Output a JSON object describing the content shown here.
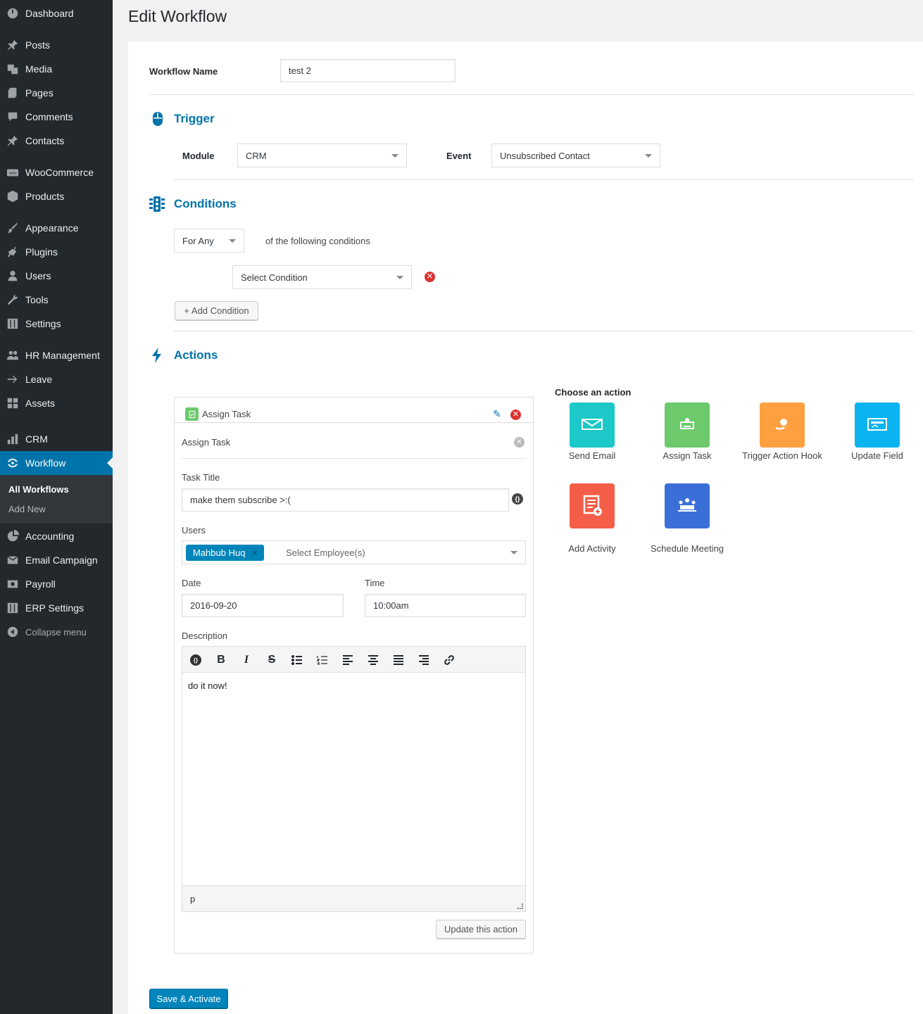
{
  "sidebar": {
    "items": [
      {
        "key": "dashboard",
        "label": "Dashboard",
        "icon": "dashboard-icon"
      },
      {
        "key": "posts",
        "label": "Posts",
        "icon": "pin-icon"
      },
      {
        "key": "media",
        "label": "Media",
        "icon": "media-icon"
      },
      {
        "key": "pages",
        "label": "Pages",
        "icon": "pages-icon"
      },
      {
        "key": "comments",
        "label": "Comments",
        "icon": "comment-icon"
      },
      {
        "key": "contacts",
        "label": "Contacts",
        "icon": "pin-icon"
      },
      {
        "key": "woocommerce",
        "label": "WooCommerce",
        "icon": "woo-icon"
      },
      {
        "key": "products",
        "label": "Products",
        "icon": "box-icon"
      },
      {
        "key": "appearance",
        "label": "Appearance",
        "icon": "brush-icon"
      },
      {
        "key": "plugins",
        "label": "Plugins",
        "icon": "plug-icon"
      },
      {
        "key": "users",
        "label": "Users",
        "icon": "user-icon"
      },
      {
        "key": "tools",
        "label": "Tools",
        "icon": "wrench-icon"
      },
      {
        "key": "settings",
        "label": "Settings",
        "icon": "sliders-icon"
      },
      {
        "key": "hr",
        "label": "HR Management",
        "icon": "people-icon"
      },
      {
        "key": "leave",
        "label": "Leave",
        "icon": "arrow-right-icon"
      },
      {
        "key": "assets",
        "label": "Assets",
        "icon": "grid-icon"
      },
      {
        "key": "crm",
        "label": "CRM",
        "icon": "bars-icon"
      },
      {
        "key": "workflow",
        "label": "Workflow",
        "icon": "workflow-icon"
      },
      {
        "key": "accounting",
        "label": "Accounting",
        "icon": "pie-icon"
      },
      {
        "key": "email",
        "label": "Email Campaign",
        "icon": "email-icon"
      },
      {
        "key": "payroll",
        "label": "Payroll",
        "icon": "money-icon"
      },
      {
        "key": "erp",
        "label": "ERP Settings",
        "icon": "sliders-icon"
      }
    ],
    "submenu": {
      "all": "All Workflows",
      "add": "Add New"
    },
    "collapse": "Collapse menu"
  },
  "page": {
    "title": "Edit Workflow"
  },
  "workflow": {
    "name_label": "Workflow Name",
    "name_value": "test 2"
  },
  "trigger": {
    "title": "Trigger",
    "module_label": "Module",
    "module_value": "CRM",
    "event_label": "Event",
    "event_value": "Unsubscribed Contact"
  },
  "conditions": {
    "title": "Conditions",
    "match_value": "For Any",
    "match_suffix": "of the following conditions",
    "condition_placeholder": "Select Condition",
    "add_label": "+ Add Condition"
  },
  "actions": {
    "title": "Actions",
    "card": {
      "header": "Assign Task",
      "subheader": "Assign Task",
      "task_title_label": "Task Title",
      "task_title_value": "make them subscribe >:(",
      "users_label": "Users",
      "user_tag": "Mahbub Huq",
      "user_placeholder": "Select Employee(s)",
      "date_label": "Date",
      "date_value": "2016-09-20",
      "time_label": "Time",
      "time_value": "10:00am",
      "description_label": "Description",
      "description_value": "do it now!",
      "editor_path": "p",
      "update_label": "Update this action"
    },
    "choose": {
      "title": "Choose an action",
      "options": [
        {
          "label": "Send Email",
          "color": "#1cc8c8"
        },
        {
          "label": "Assign Task",
          "color": "#6cc96c"
        },
        {
          "label": "Trigger Action Hook",
          "color": "#ffa040"
        },
        {
          "label": "Update Field",
          "color": "#09b4f0"
        },
        {
          "label": "Add Activity",
          "color": "#f45d48"
        },
        {
          "label": "Schedule Meeting",
          "color": "#3a6fd8"
        }
      ]
    }
  },
  "footer": {
    "save_label": "Save & Activate"
  }
}
